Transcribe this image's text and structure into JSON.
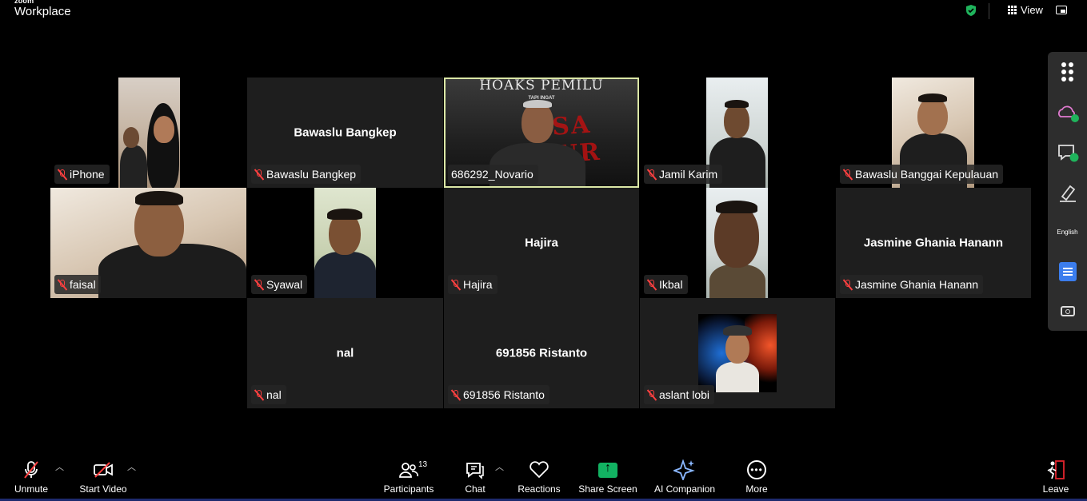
{
  "app": {
    "brand_small": "zoom",
    "brand_name": "Workplace"
  },
  "header": {
    "view_label": "View"
  },
  "tiles": [
    {
      "name": "iPhone",
      "center_name": ""
    },
    {
      "name": "Bawaslu Bangkep",
      "center_name": "Bawaslu Bangkep"
    },
    {
      "name": "686292_Novario",
      "center_name": ""
    },
    {
      "name": "Jamil Karim",
      "center_name": ""
    },
    {
      "name": "Bawaslu Banggai Kepulauan",
      "center_name": ""
    },
    {
      "name": "faisal",
      "center_name": ""
    },
    {
      "name": "Syawal",
      "center_name": ""
    },
    {
      "name": "Hajira",
      "center_name": "Hajira"
    },
    {
      "name": "Ikbal",
      "center_name": ""
    },
    {
      "name": "Jasmine Ghania Hanann",
      "center_name": "Jasmine Ghania Hanann"
    },
    {
      "name": "nal",
      "center_name": "nal"
    },
    {
      "name": "691856 Ristanto",
      "center_name": "691856 Ristanto"
    },
    {
      "name": "aslant lobi",
      "center_name": ""
    }
  ],
  "shared_video": {
    "title": "HOAKS PEMILU",
    "subtitle": "TAPI INGAT",
    "overlay": "TSA OUR"
  },
  "side_panel": {
    "english_label": "English"
  },
  "toolbar": {
    "unmute": "Unmute",
    "start_video": "Start Video",
    "participants": "Participants",
    "participants_count": "13",
    "chat": "Chat",
    "reactions": "Reactions",
    "share_screen": "Share Screen",
    "ai_companion": "AI Companion",
    "more": "More",
    "leave": "Leave"
  },
  "colors": {
    "share_green": "#12b262",
    "muted_red": "#ff4040",
    "active_outline": "#dbe7a6",
    "leave_red": "#e0242c"
  }
}
